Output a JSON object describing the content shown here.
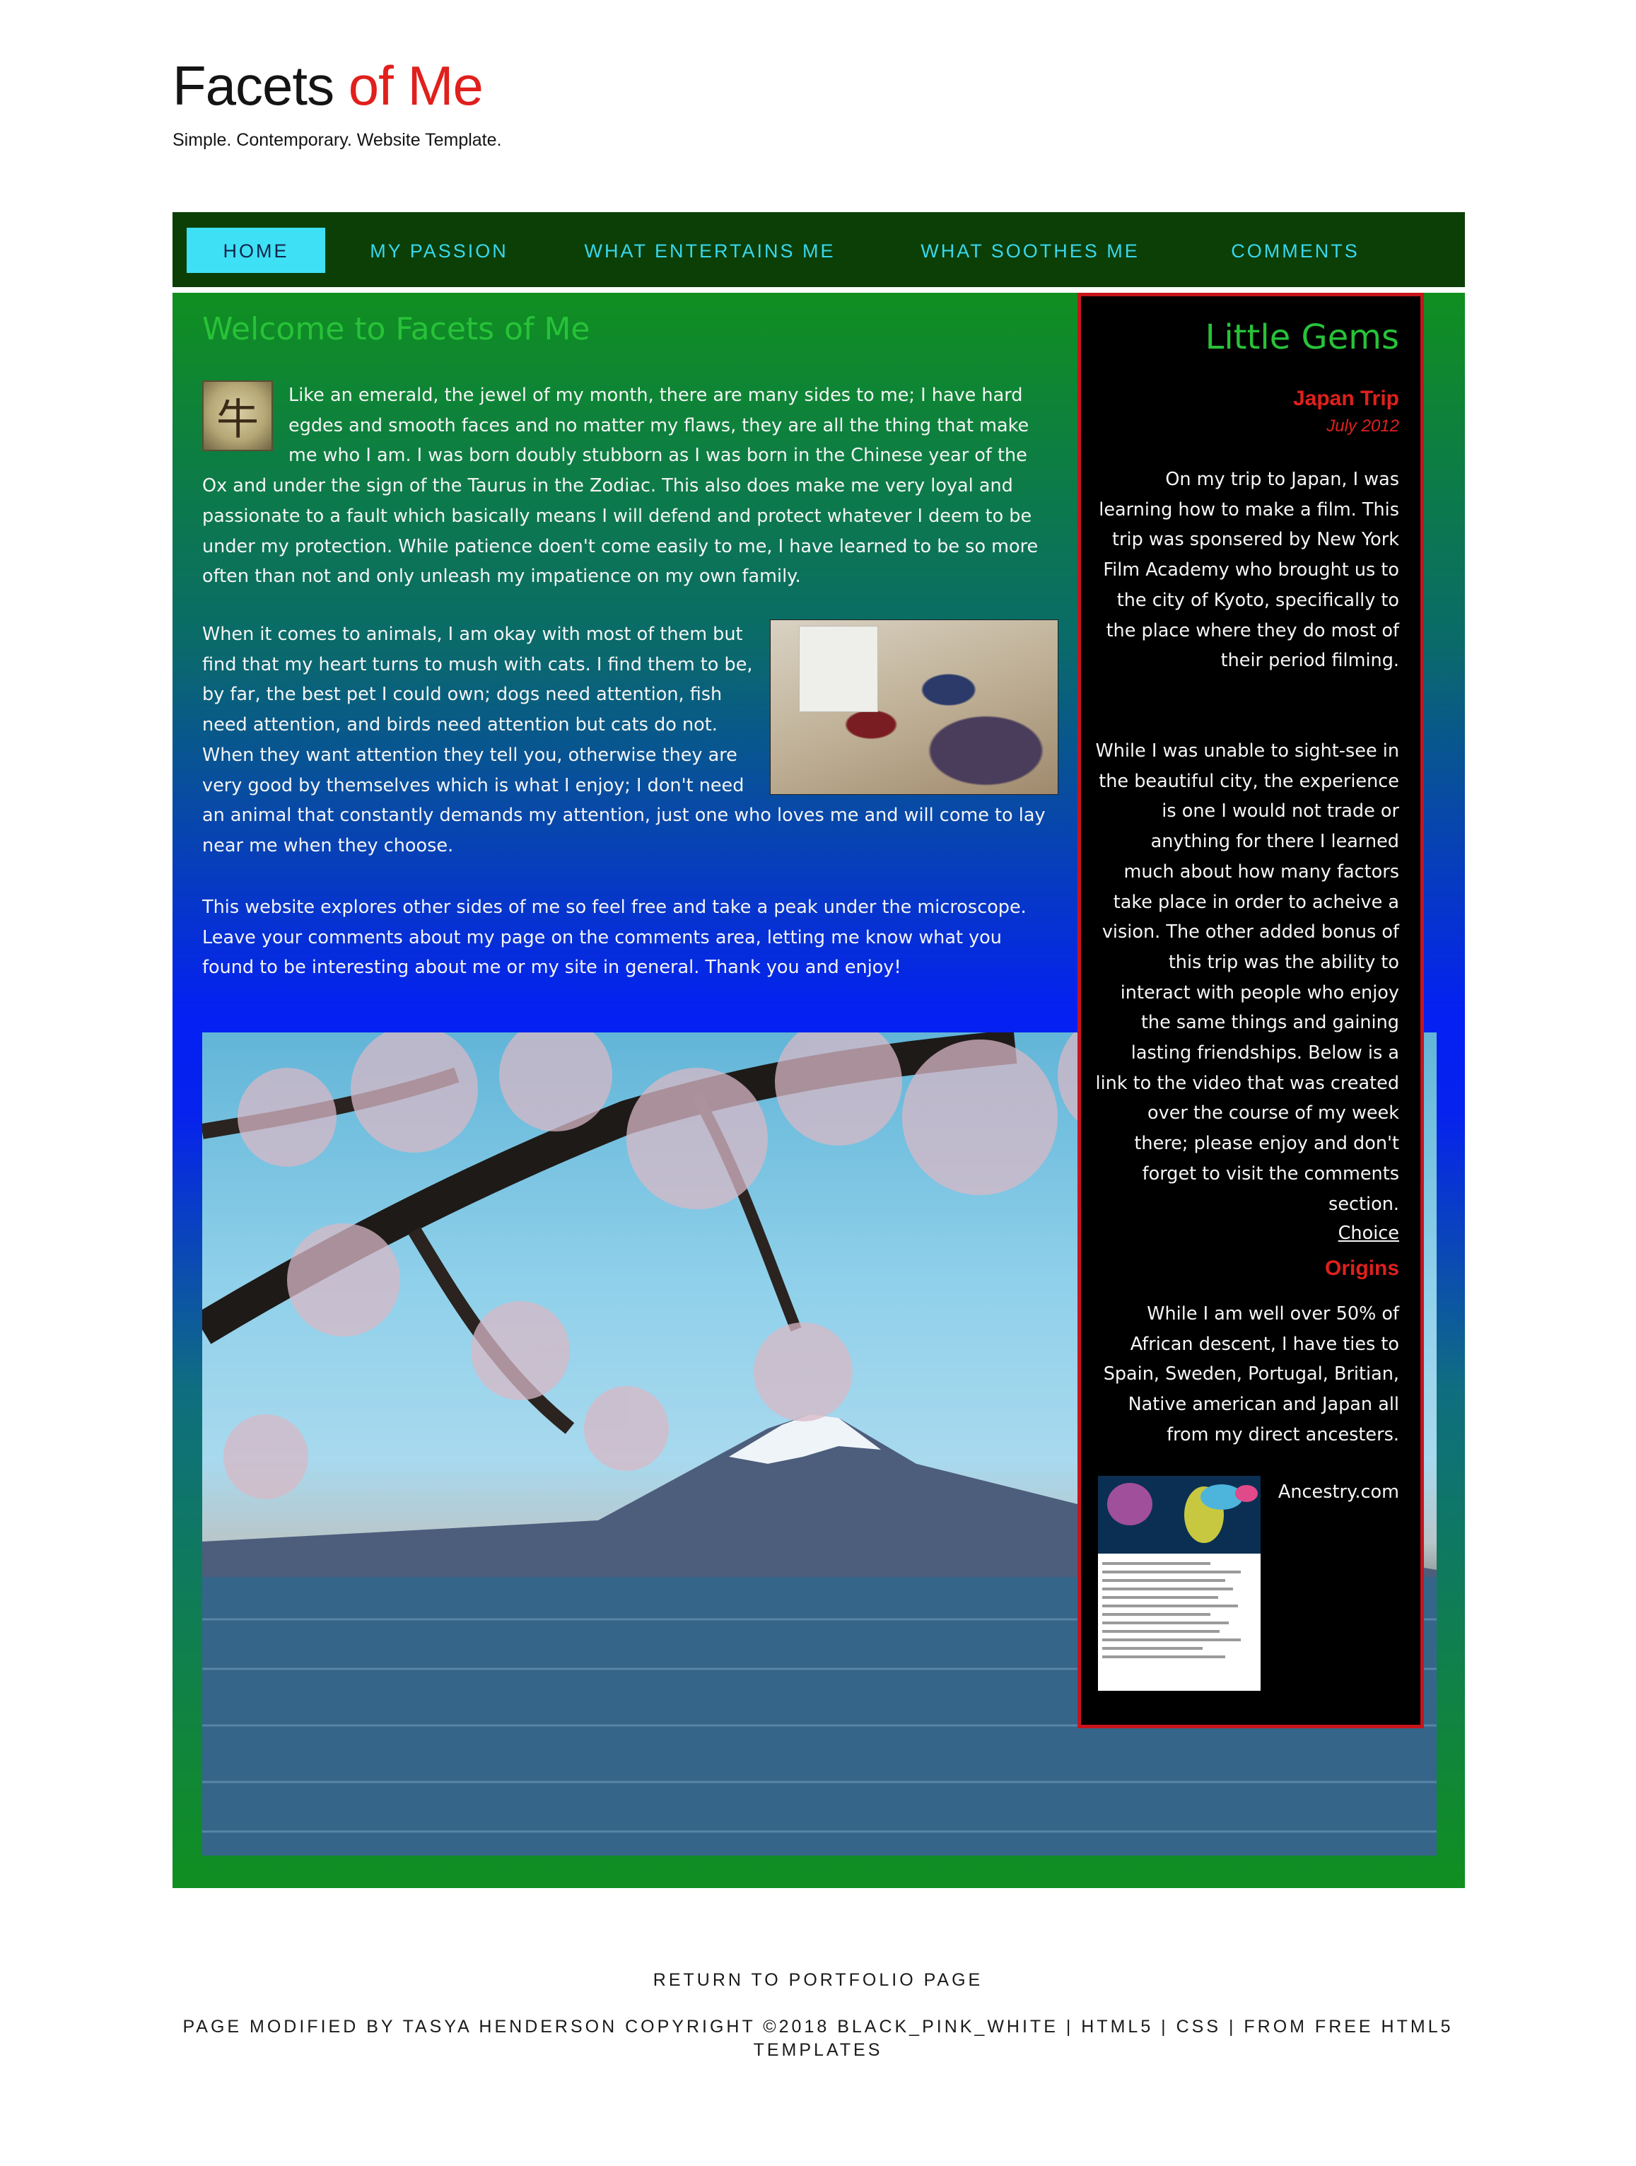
{
  "header": {
    "logo_part1": "Facets ",
    "logo_part2": "of Me",
    "tagline": "Simple. Contemporary. Website Template."
  },
  "nav": {
    "items": [
      {
        "label": "HOME",
        "active": true
      },
      {
        "label": "MY PASSION",
        "active": false
      },
      {
        "label": "WHAT ENTERTAINS ME",
        "active": false
      },
      {
        "label": "WHAT SOOTHES ME",
        "active": false
      },
      {
        "label": "COMMENTS",
        "active": false
      }
    ]
  },
  "main": {
    "heading": "Welcome to Facets of Me",
    "paragraph1": "Like an emerald, the jewel of my month, there are many sides to me; I have hard egdes and smooth faces and no matter my flaws, they are all the thing that make me who I am. I was born doubly stubborn as I was born in the Chinese year of the Ox and under the sign of the Taurus in the Zodiac. This also does make me very loyal and passionate to a fault which basically means I will defend and protect whatever I deem to be under my protection. While patience doen't come easily to me, I have learned to be so more often than not and only unleash my impatience on my own family.",
    "paragraph2": "When it comes to animals, I am okay with most of them but find that my heart turns to mush with cats. I find them to be, by far, the best pet I could own; dogs need attention, fish need attention, and birds need attention but cats do not. When they want attention they tell you, otherwise they are very good by themselves which is what I enjoy; I don't need an animal that constantly demands my attention, just one who loves me and will come to lay near me when they choose.",
    "paragraph3": "This website explores other sides of me so feel free and take a peak under the microscope. Leave your comments about my page on the comments area, letting me know what you found to be interesting about me or my site in general. Thank you and enjoy!",
    "ox_glyph": "牛"
  },
  "sidebar": {
    "title": "Little Gems",
    "item1_heading": "Japan Trip",
    "item1_date": "July 2012",
    "item1_text_a": "On my trip to Japan, I was learning how to make a film. This trip was sponsered by New York Film Academy who brought us to the city of Kyoto, specifically to the place where they do most of their period filming.",
    "item1_text_b": "While I was unable to sight-see in the beautiful city, the experience is one I would not trade or anything for there I learned much about how many factors take place in order to acheive a vision. The other added bonus of this trip was the ability to interact with people who enjoy the same things and gaining lasting friendships. Below is a link to the video that was created over the course of my week there; please enjoy and don't forget to visit the comments section.",
    "item1_link": "Choice",
    "item2_heading": "Origins",
    "item2_text": "While I am well over 50% of African descent, I have ties to Spain, Sweden, Portugal, Britian, Native american and Japan all from my direct ancesters.",
    "item2_link": "Ancestry.com"
  },
  "footer": {
    "return_link": "RETURN TO PORTFOLIO PAGE",
    "copyright": "PAGE MODIFIED BY TASYA HENDERSON COPYRIGHT ©2018 BLACK_PINK_WHITE | HTML5 | CSS | FROM FREE HTML5 TEMPLATES"
  },
  "colors": {
    "accent_red": "#e0201c",
    "nav_bg": "#0b3f06",
    "nav_text": "#39d7ee",
    "heading_green": "#28c238"
  }
}
